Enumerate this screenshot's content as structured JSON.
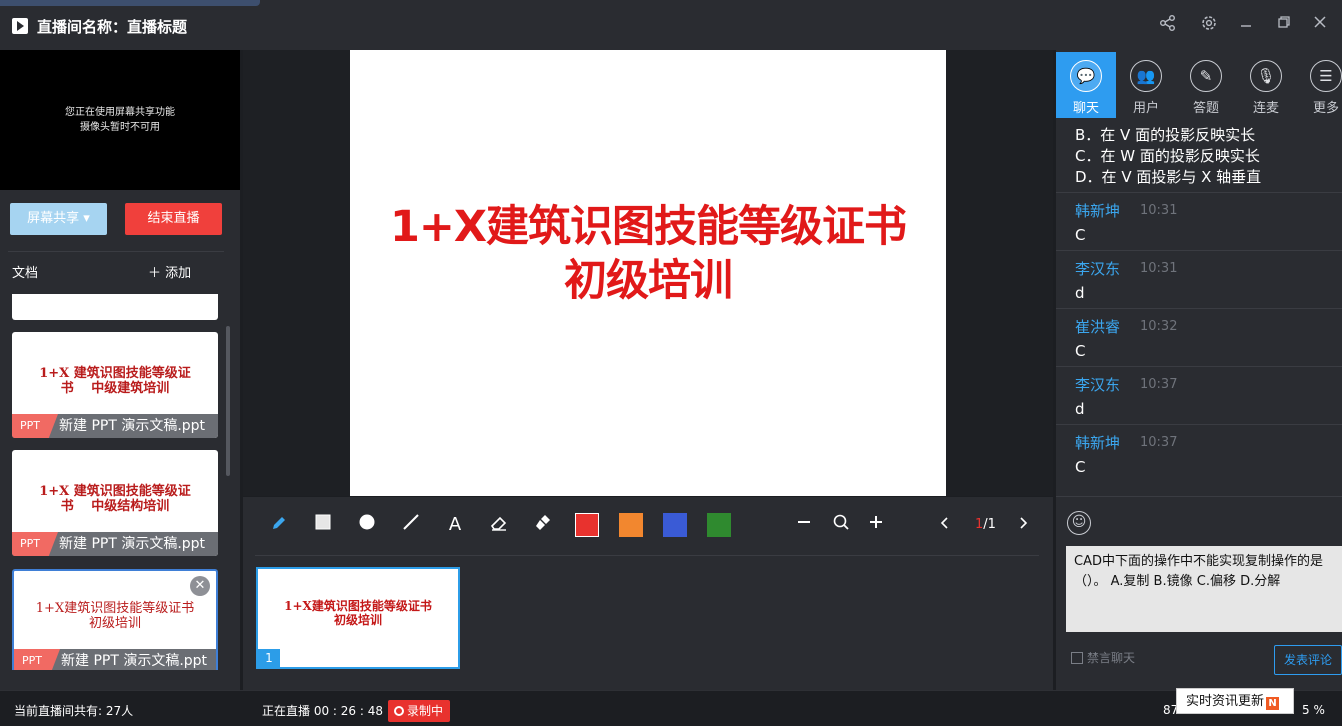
{
  "window": {
    "title": "直播间名称：直播标题",
    "buttons": [
      "share-icon",
      "settings-icon",
      "minimize-icon",
      "restore-icon",
      "close-icon"
    ]
  },
  "camera": {
    "line1": "您正在使用屏幕共享功能",
    "line2": "摄像头暂时不可用"
  },
  "controls": {
    "share_label": "屏幕共享 ▾",
    "end_label": "结束直播"
  },
  "documents": {
    "header": "文档",
    "add_label": "＋ 添加",
    "items": [
      {
        "title_lines": [
          "1+X 建筑识图技能等级证",
          "书 　中级建筑培训"
        ],
        "tag": "PPT",
        "name": "新建 PPT 演示文稿.ppt"
      },
      {
        "title_lines": [
          "1+X 建筑识图技能等级证",
          "书 　中级结构培训"
        ],
        "tag": "PPT",
        "name": "新建 PPT 演示文稿.ppt"
      },
      {
        "title_lines": [
          "1+X建筑识图技能等级证书",
          "初级培训"
        ],
        "tag": "PPT",
        "name": "新建 PPT 演示文稿.ppt"
      }
    ]
  },
  "slide": {
    "line1": "1+X建筑识图技能等级证书",
    "line2": "初级培训"
  },
  "toolbar": {
    "colors": [
      "#e8322e",
      "#f2872f",
      "#3a5bd6",
      "#2f8a2f"
    ],
    "page_current": "1",
    "page_total": "/1"
  },
  "thumbnail": {
    "line1": "1+X建筑识图技能等级证书",
    "line2": "初级培训",
    "number": "1"
  },
  "tabs": [
    {
      "label": "聊天",
      "icon": "chat-icon",
      "active": true
    },
    {
      "label": "用户",
      "icon": "users-icon",
      "active": false
    },
    {
      "label": "答题",
      "icon": "pen-icon",
      "active": false
    },
    {
      "label": "连麦",
      "icon": "mic-icon",
      "active": false
    },
    {
      "label": "更多",
      "icon": "list-icon",
      "active": false
    }
  ],
  "chat": {
    "options": [
      "B．在 V 面的投影反映实长",
      "C．在 W 面的投影反映实长",
      "D．在 V 面投影与 X 轴垂直"
    ],
    "messages": [
      {
        "name": "韩新坤",
        "time": "10:31",
        "text": "C"
      },
      {
        "name": "李汉东",
        "time": "10:31",
        "text": "d"
      },
      {
        "name": "崔洪睿",
        "time": "10:32",
        "text": "C"
      },
      {
        "name": "李汉东",
        "time": "10:37",
        "text": "d"
      },
      {
        "name": "韩新坤",
        "time": "10:37",
        "text": "C"
      }
    ],
    "input_text": "CAD中下面的操作中不能实现复制操作的是（）。 A.复制 B.镜像 C.偏移 D.分解",
    "mute_label": "禁言聊天",
    "post_label": "发表评论"
  },
  "status": {
    "viewers": "当前直播间共有: 27人",
    "live": "正在直播 00 : 26 : 48",
    "recording": "录制中",
    "news": "实时资讯更新",
    "news_badge": "N",
    "right1": "87",
    "right2": "5 %"
  }
}
